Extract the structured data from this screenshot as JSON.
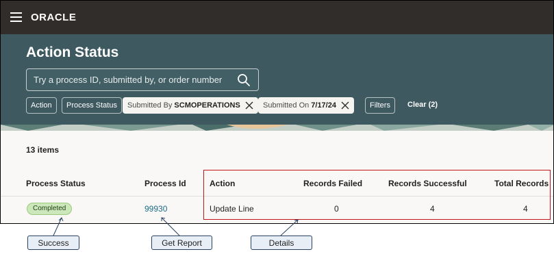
{
  "header": {
    "logo": "ORACLE",
    "title": "Action Status",
    "search_placeholder": "Try a process ID, submitted by, or order number",
    "chips": {
      "action": "Action",
      "process_status": "Process Status",
      "submitted_by_label": "Submitted By",
      "submitted_by_value": "SCMOPERATIONS",
      "submitted_on_label": "Submitted On",
      "submitted_on_value": "7/17/24",
      "filters": "Filters"
    },
    "clear": "Clear (2)"
  },
  "results": {
    "count": "13 items",
    "columns": [
      "Process Status",
      "Process Id",
      "Action",
      "Records Failed",
      "Records Successful",
      "Total Records"
    ],
    "rows": [
      {
        "process_status": "Completed",
        "process_id": "99930",
        "action": "Update Line",
        "records_failed": "0",
        "records_successful": "4",
        "total_records": "4"
      }
    ]
  },
  "callouts": {
    "success": "Success",
    "get_report": "Get Report",
    "details": "Details"
  },
  "colors": {
    "topbar": "#312d2a",
    "header": "#3e5a60",
    "badge_bg": "#cce7b9",
    "link": "#1b6b86",
    "highlight": "#c0161b"
  }
}
